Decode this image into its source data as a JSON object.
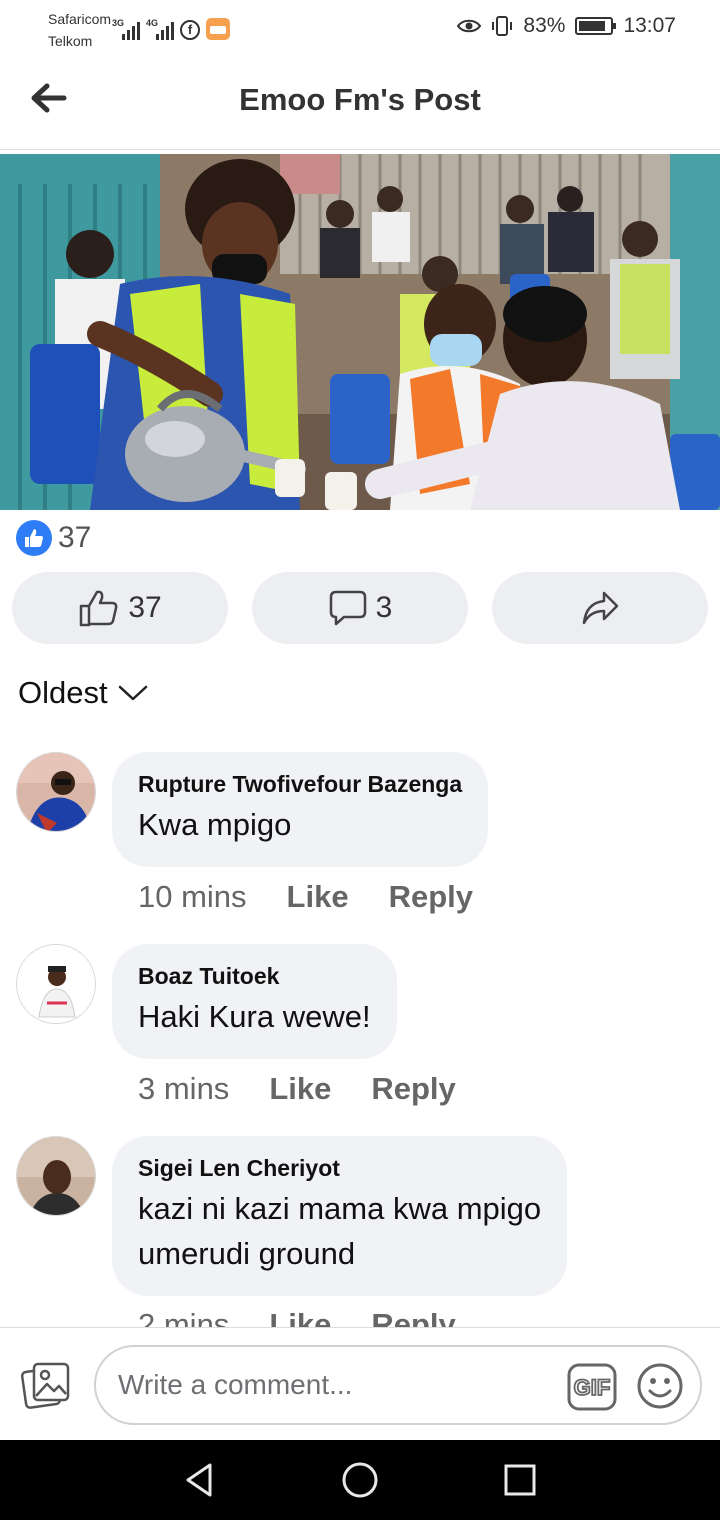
{
  "status_bar": {
    "carrier_1": "Safaricom",
    "carrier_2": "Telkom",
    "net_1": "3G",
    "net_2": "4G",
    "battery": "83%",
    "time": "13:07"
  },
  "header": {
    "title": "Emoo Fm's Post"
  },
  "reactions": {
    "summary_count": "37"
  },
  "actions": {
    "like_count": "37",
    "comment_count": "3"
  },
  "sort": {
    "label": "Oldest"
  },
  "comments": [
    {
      "name": "Rupture Twofivefour Bazenga",
      "text": "Kwa mpigo",
      "time": "10 mins",
      "like": "Like",
      "reply": "Reply"
    },
    {
      "name": "Boaz Tuitoek",
      "text": "Haki Kura wewe!",
      "time": "3 mins",
      "like": "Like",
      "reply": "Reply"
    },
    {
      "name": "Sigei Len Cheriyot",
      "text_line_1": "kazi ni kazi mama kwa mpigo",
      "text_line_2": "umerudi ground",
      "time": "2 mins",
      "like": "Like",
      "reply": "Reply"
    }
  ],
  "composer": {
    "placeholder": "Write a comment..."
  }
}
